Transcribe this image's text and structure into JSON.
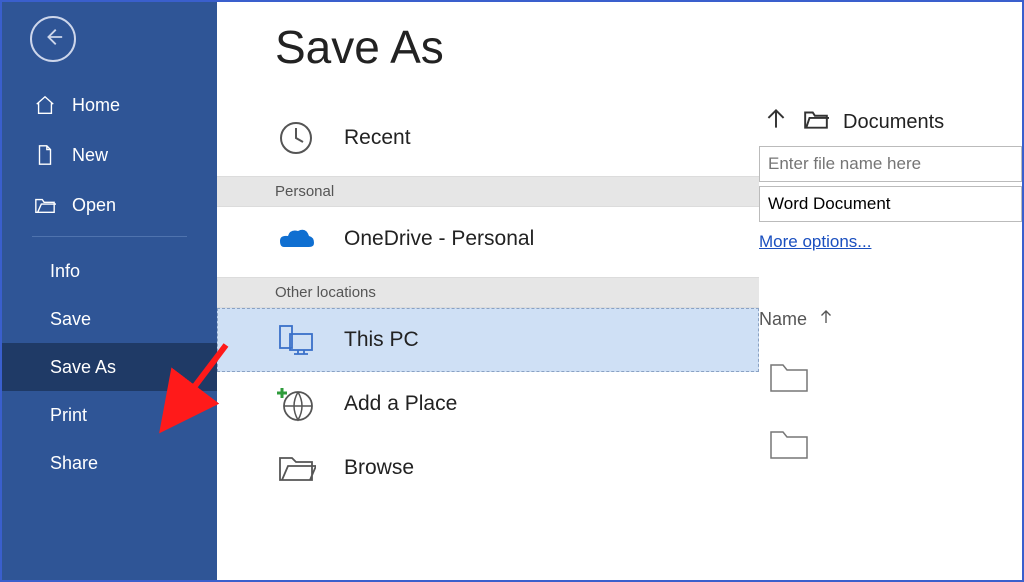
{
  "page_title": "Save As",
  "sidebar": {
    "nav": [
      {
        "id": "home",
        "label": "Home"
      },
      {
        "id": "new",
        "label": "New"
      },
      {
        "id": "open",
        "label": "Open"
      }
    ],
    "sub": [
      {
        "id": "info",
        "label": "Info"
      },
      {
        "id": "save",
        "label": "Save"
      },
      {
        "id": "save-as",
        "label": "Save As",
        "selected": true
      },
      {
        "id": "print",
        "label": "Print"
      },
      {
        "id": "share",
        "label": "Share"
      }
    ]
  },
  "locations": {
    "recent_label": "Recent",
    "section_personal": "Personal",
    "onedrive_label": "OneDrive - Personal",
    "section_other": "Other locations",
    "this_pc_label": "This PC",
    "add_place_label": "Add a Place",
    "browse_label": "Browse"
  },
  "right": {
    "breadcrumb": "Documents",
    "filename_placeholder": "Enter file name here",
    "filename_value": "",
    "filetype_selected": "Word Document",
    "more_options": "More options...",
    "column_header": "Name"
  }
}
